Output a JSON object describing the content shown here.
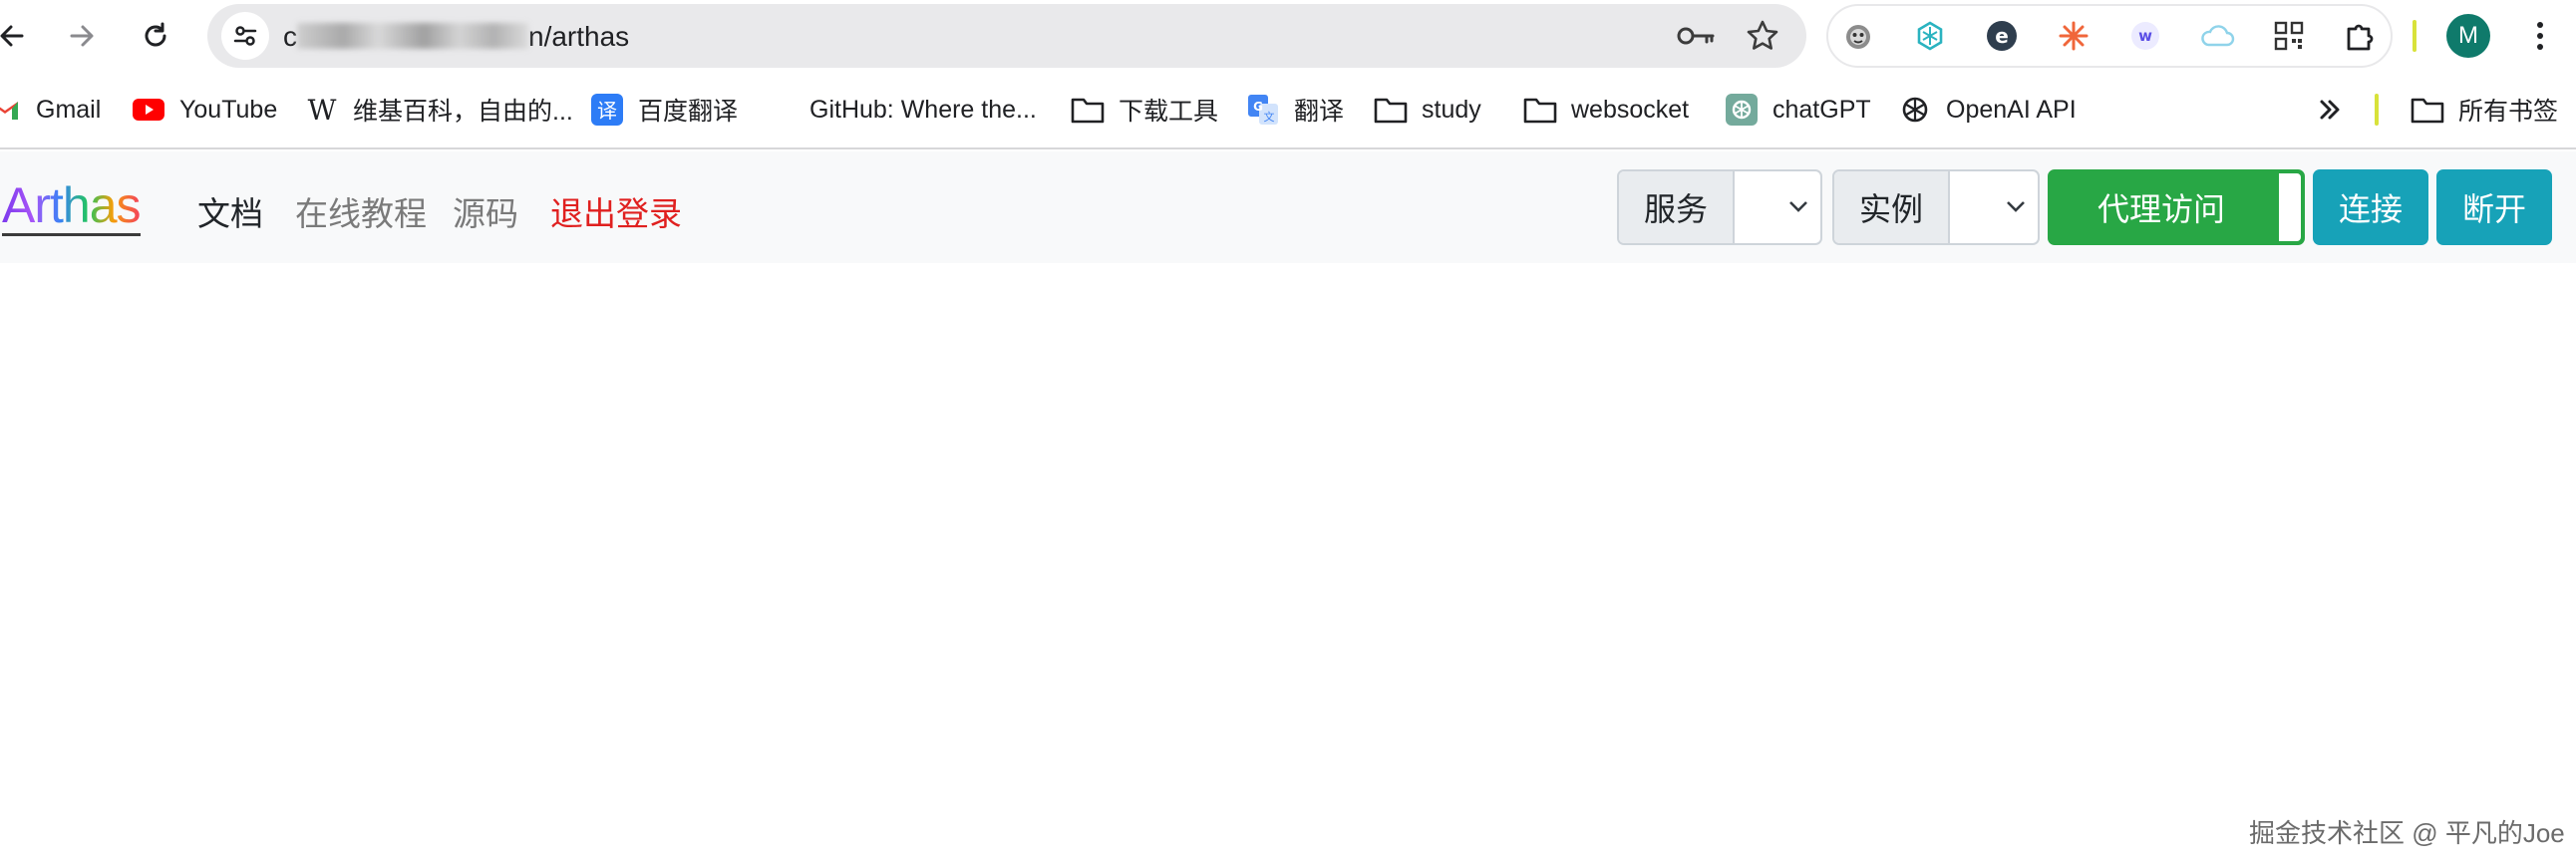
{
  "browser": {
    "url_prefix": "c",
    "url_suffix": "n/arthas",
    "profile_initial": "M"
  },
  "bookmarks": [
    {
      "label": "Gmail",
      "icon": "gmail-icon"
    },
    {
      "label": "YouTube",
      "icon": "youtube-icon"
    },
    {
      "label": "维基百科，自由的...",
      "icon": "wikipedia-icon"
    },
    {
      "label": "百度翻译",
      "icon": "baidu-translate-icon"
    },
    {
      "label": "GitHub: Where the...",
      "icon": "github-icon"
    },
    {
      "label": "下载工具",
      "icon": "folder-icon"
    },
    {
      "label": "翻译",
      "icon": "google-translate-icon"
    },
    {
      "label": "study",
      "icon": "folder-icon"
    },
    {
      "label": "websocket",
      "icon": "folder-icon"
    },
    {
      "label": "chatGPT",
      "icon": "chatgpt-icon"
    },
    {
      "label": "OpenAI API",
      "icon": "openai-icon"
    },
    {
      "label": "所有书签",
      "icon": "folder-icon"
    }
  ],
  "app": {
    "logo": "Arthas",
    "nav": {
      "docs": "文档",
      "tutorial": "在线教程",
      "source": "源码",
      "logout": "退出登录"
    },
    "service_label": "服务",
    "instance_label": "实例",
    "proxy_label": "代理访问",
    "connect_label": "连接",
    "disconnect_label": "断开",
    "colors": {
      "proxy": "#28a745",
      "connect": "#17a2b8",
      "logout": "#e0201f"
    }
  },
  "watermark": "掘金技术社区 @ 平凡的Joe"
}
